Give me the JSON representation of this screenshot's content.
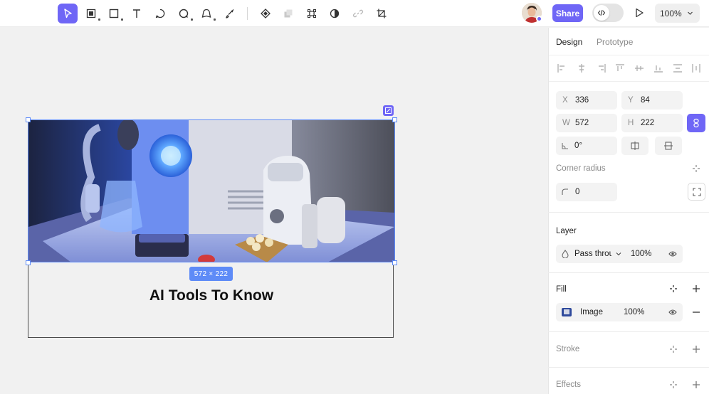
{
  "toolbar": {
    "tools": [
      "move-tool",
      "frame-tool",
      "rectangle-tool",
      "text-tool",
      "comment-tool",
      "ellipse-tool",
      "shape-tool",
      "pen-tool",
      "component-tool",
      "boolean-tool",
      "vector-tool",
      "mask-tool",
      "link-tool",
      "crop-tool"
    ],
    "share_label": "Share",
    "zoom_label": "100%"
  },
  "canvas": {
    "frame_title": "AI Tools To Know",
    "selection_size": "572 × 222"
  },
  "panel": {
    "tabs": {
      "design": "Design",
      "prototype": "Prototype"
    },
    "position": {
      "x_label": "X",
      "x_value": "336",
      "y_label": "Y",
      "y_value": "84"
    },
    "size": {
      "w_label": "W",
      "w_value": "572",
      "h_label": "H",
      "h_value": "222"
    },
    "rotation_value": "0°",
    "corner_radius_label": "Corner radius",
    "corner_radius_value": "0",
    "layer": {
      "title": "Layer",
      "blend_mode": "Pass throu",
      "opacity": "100%"
    },
    "fill": {
      "title": "Fill",
      "type": "Image",
      "opacity": "100%"
    },
    "stroke_title": "Stroke",
    "effects_title": "Effects"
  },
  "colors": {
    "accent": "#6f66f6",
    "selection": "#5e8bf7"
  }
}
